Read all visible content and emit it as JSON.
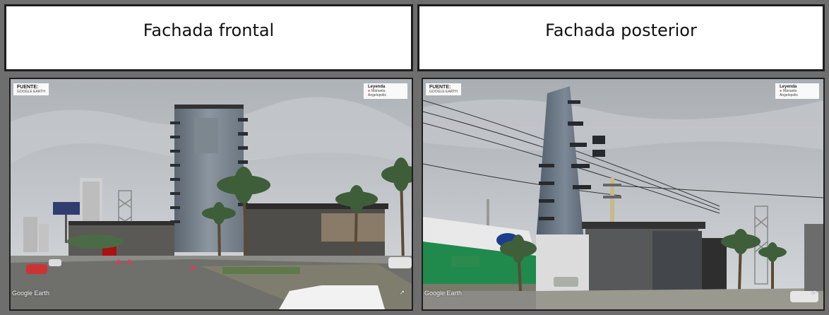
{
  "table": {
    "headers": [
      {
        "label": "Fachada frontal"
      },
      {
        "label": "Fachada posterior"
      }
    ],
    "photos": [
      {
        "source_title": "FUENTE:",
        "source_name": "GOOGLE EARTH",
        "legend_title": "Leyenda",
        "legend_item": "Manuela Angelopolis",
        "watermark": "Google Earth",
        "compass": "↗"
      },
      {
        "source_title": "FUENTE:",
        "source_name": "GOOGLE EARTH",
        "legend_title": "Leyenda",
        "legend_item": "Manuela Angelopolis",
        "watermark": "Google Earth",
        "compass": "↗"
      }
    ]
  }
}
